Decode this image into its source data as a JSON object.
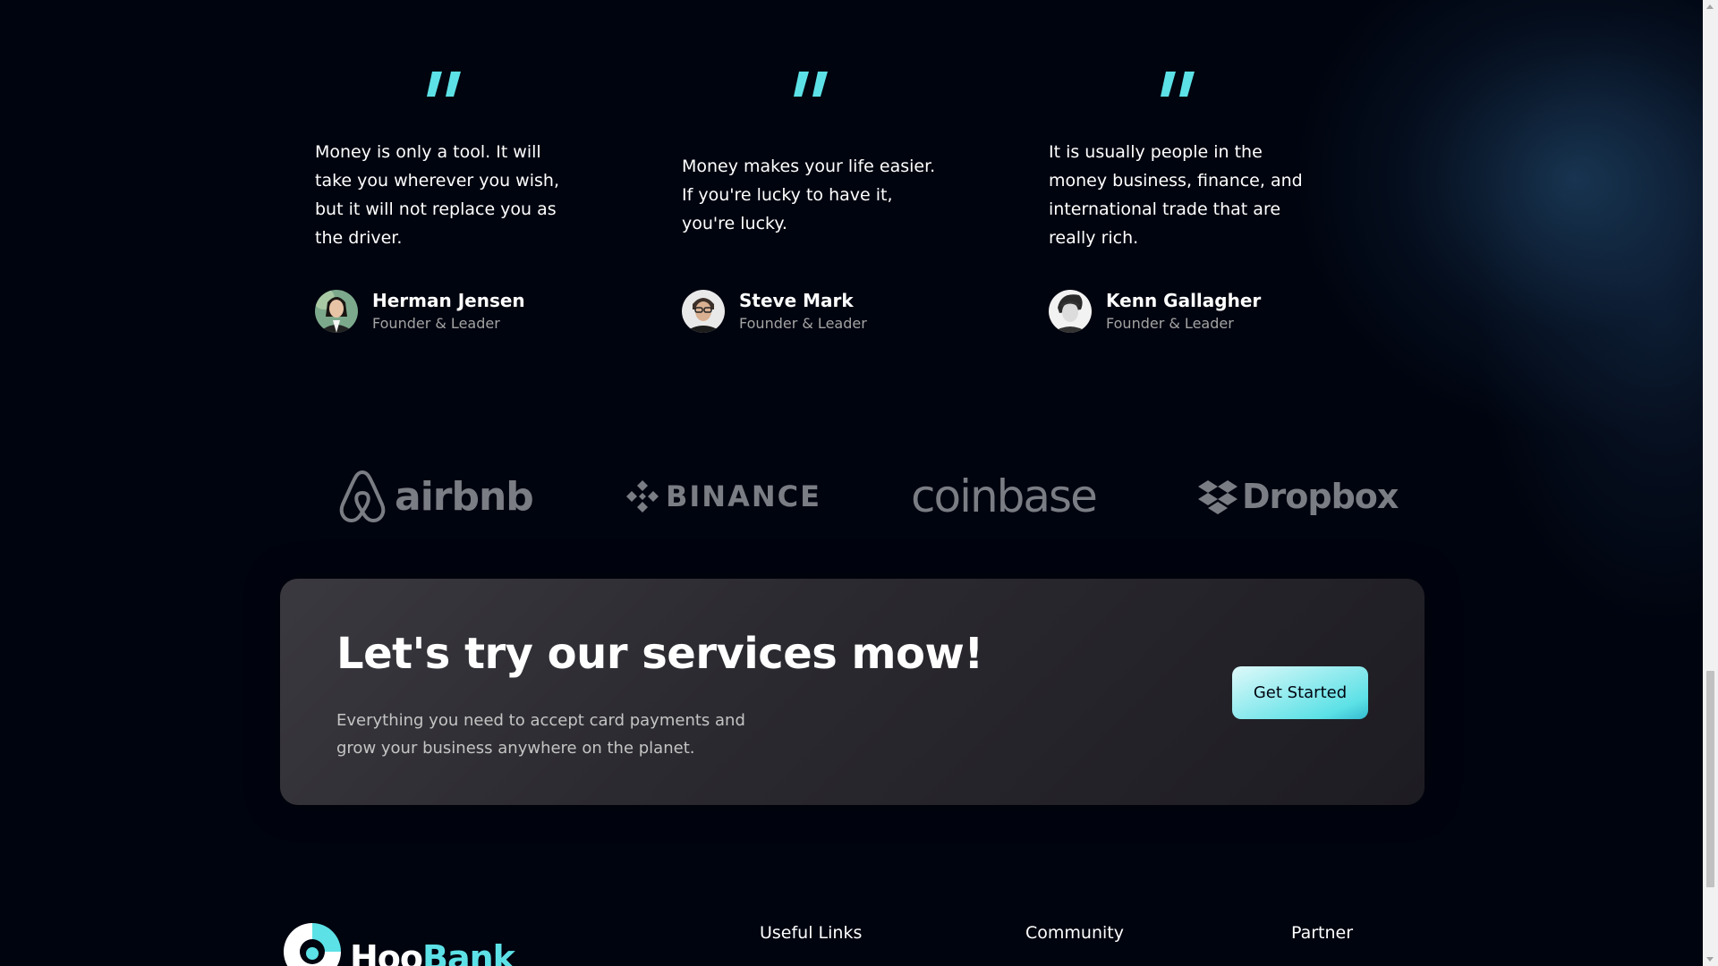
{
  "testimonials": [
    {
      "quote": "Money is only a tool. It will take you wherever you wish, but it will not replace you as the driver.",
      "name": "Herman Jensen",
      "title": "Founder & Leader"
    },
    {
      "quote": "Money makes your life easier. If you're lucky to have it, you're lucky.",
      "name": "Steve Mark",
      "title": "Founder & Leader"
    },
    {
      "quote": "It is usually people in the money business, finance, and international trade that are really rich.",
      "name": "Kenn Gallagher",
      "title": "Founder & Leader"
    }
  ],
  "clients": {
    "airbnb": "airbnb",
    "binance": "BINANCE",
    "coinbase": "coinbase",
    "dropbox": "Dropbox"
  },
  "cta": {
    "title": "Let's try our services mow!",
    "text": "Everything you need to accept card payments and grow your business anywhere on the planet.",
    "button_label": "Get Started"
  },
  "footer": {
    "logo_part1": "Hoo",
    "logo_part2": "Bank",
    "columns": [
      {
        "title": "Useful Links"
      },
      {
        "title": "Community"
      },
      {
        "title": "Partner"
      }
    ]
  },
  "colors": {
    "background": "#00040f",
    "accent": "#5ce1e6",
    "muted_text": "#a3a3a3",
    "logo_gray": "#7b7d84"
  }
}
